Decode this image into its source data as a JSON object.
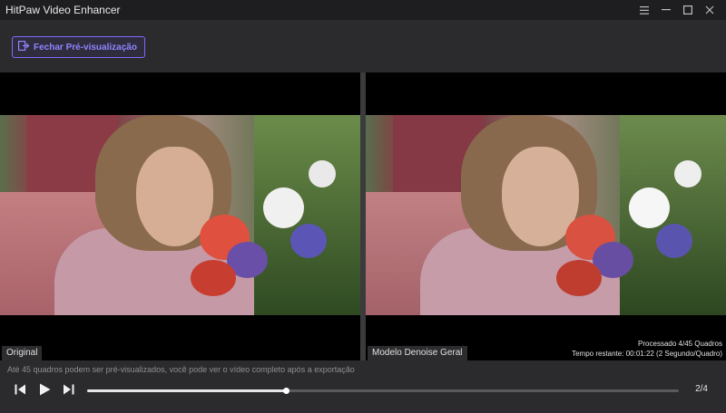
{
  "app": {
    "title": "HitPaw Video Enhancer"
  },
  "window_controls": {
    "icons": [
      "menu-icon",
      "minimize-icon",
      "maximize-icon",
      "close-icon"
    ]
  },
  "toolbar": {
    "close_preview_label": "Fechar Pré-visualização",
    "accent": "#7b6bff"
  },
  "preview": {
    "left_label": "Original",
    "right_label": "Modelo Denoise Geral",
    "status_processed": "Processado 4/45 Quadros",
    "status_remaining": "Tempo restante: 00:01:22 (2 Segundo/Quadro)"
  },
  "player": {
    "hint": "Até 45 quadros podem ser pré-visualizados, você pode ver o vídeo completo após a exportação",
    "progress_fraction": 0.337,
    "counter": "2/4"
  }
}
